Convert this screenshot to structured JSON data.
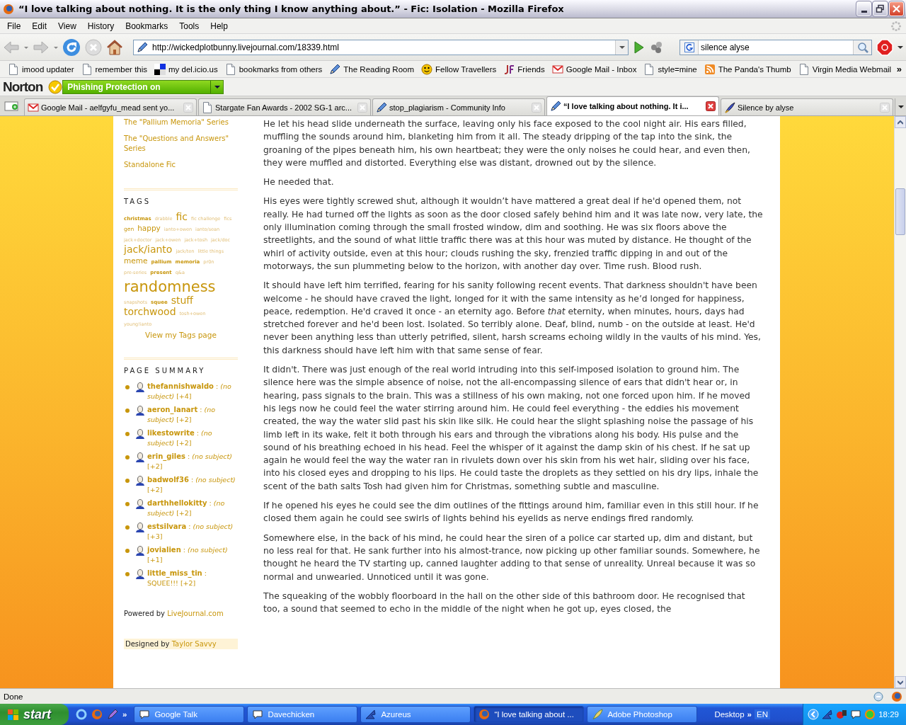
{
  "window": {
    "title": "“I love talking about nothing. It is the only thing I know anything about.” - Fic: Isolation - Mozilla Firefox"
  },
  "menu": [
    "File",
    "Edit",
    "View",
    "History",
    "Bookmarks",
    "Tools",
    "Help"
  ],
  "navigation": {
    "url": "http://wickedplotbunny.livejournal.com/18339.html",
    "search_query": "silence alyse"
  },
  "bookmarks": [
    {
      "label": "imood updater",
      "kind": "page"
    },
    {
      "label": "remember this",
      "kind": "page"
    },
    {
      "label": "my del.icio.us",
      "kind": "delicious"
    },
    {
      "label": "bookmarks from others",
      "kind": "page"
    },
    {
      "label": "The Reading Room",
      "kind": "pen"
    },
    {
      "label": "Fellow Travellers",
      "kind": "smiley"
    },
    {
      "label": "Friends",
      "kind": "monogram"
    },
    {
      "label": "Google Mail - Inbox",
      "kind": "gmail"
    },
    {
      "label": "style=mine",
      "kind": "page"
    },
    {
      "label": "The Panda's Thumb",
      "kind": "rss"
    },
    {
      "label": "Virgin Media Webmail",
      "kind": "page"
    }
  ],
  "bookmarks_overflow": "»",
  "norton": {
    "brand": "Norton",
    "status": "Phishing Protection on"
  },
  "tabs": [
    {
      "title": "Google Mail - aelfgyfu_mead sent yo...",
      "kind": "gmail",
      "selected": false
    },
    {
      "title": "Stargate Fan Awards - 2002 SG-1 arc...",
      "kind": "page",
      "selected": false
    },
    {
      "title": "stop_plagiarism - Community Info",
      "kind": "pen",
      "selected": false
    },
    {
      "title": "“I love talking about nothing. It i...",
      "kind": "pen",
      "selected": true
    },
    {
      "title": "Silence by alyse",
      "kind": "quill",
      "selected": false
    }
  ],
  "sidebar": {
    "series": [
      "The \"Pallium Memoria\" Series",
      "The \"Questions and Answers\" Series",
      "Standalone Fic"
    ],
    "tags_heading": "TAGS",
    "tags": [
      {
        "label": "christmas",
        "kind": "bold"
      },
      {
        "label": "drabble",
        "kind": "pale"
      },
      {
        "label": "fic",
        "kind": "large"
      },
      {
        "label": "fic challenge",
        "kind": "pale"
      },
      {
        "label": "fics",
        "kind": "pale"
      },
      {
        "label": "gen",
        "kind": "small"
      },
      {
        "label": "happy",
        "kind": "medium"
      },
      {
        "label": "ianto+owen",
        "kind": "pale"
      },
      {
        "label": "ianto/sean",
        "kind": "pale"
      },
      {
        "label": "jack+doctor",
        "kind": "pale"
      },
      {
        "label": "jack+owen",
        "kind": "pale"
      },
      {
        "label": "jack+tosh",
        "kind": "pale"
      },
      {
        "label": "jack/doc",
        "kind": "pale"
      },
      {
        "label": "jack/ianto",
        "kind": "large"
      },
      {
        "label": "jack/ten",
        "kind": "pale"
      },
      {
        "label": "little things",
        "kind": "pale"
      },
      {
        "label": "meme",
        "kind": "medium"
      },
      {
        "label": "pallium",
        "kind": "bold"
      },
      {
        "label": "memoria",
        "kind": "bold"
      },
      {
        "label": "pr0n",
        "kind": "pale"
      },
      {
        "label": "pre-series",
        "kind": "pale"
      },
      {
        "label": "present",
        "kind": "bold"
      },
      {
        "label": "q&a",
        "kind": "pale"
      },
      {
        "label": "randomness",
        "kind": "huge"
      },
      {
        "label": "snapshots",
        "kind": "pale"
      },
      {
        "label": "squee",
        "kind": "bold"
      },
      {
        "label": "stuff",
        "kind": "large"
      },
      {
        "label": "torchwood",
        "kind": "large"
      },
      {
        "label": "tosh+owen",
        "kind": "pale"
      },
      {
        "label": "young!ianto",
        "kind": "pale"
      }
    ],
    "tags_link": "View my Tags page",
    "summary_heading": "PAGE SUMMARY",
    "summary": [
      {
        "user": "thefannishwaldo",
        "entry": ": *(no subject)* [+4]"
      },
      {
        "user": "aeron_lanart",
        "entry": ": *(no subject)* [+2]"
      },
      {
        "user": "likestowrite",
        "entry": ": *(no subject)* [+2]"
      },
      {
        "user": "erin_giles",
        "entry": ": *(no subject)* [+2]"
      },
      {
        "user": "badwolf36",
        "entry": ": *(no subject)* [+2]"
      },
      {
        "user": "darthhellokitty",
        "entry": ": *(no subject)* [+2]"
      },
      {
        "user": "estsilvara",
        "entry": ": *(no subject)* [+3]"
      },
      {
        "user": "jovialien",
        "entry": ": *(no subject)* [+1]"
      },
      {
        "user": "little_miss_tin",
        "entry": ": SQUEE!!! [+2]"
      }
    ],
    "powered_label": "Powered by",
    "powered_link": "LiveJournal.com",
    "designed_label": "Designed by",
    "designed_link": "Taylor Savvy"
  },
  "paragraphs": [
    "He let his head slide underneath the surface, leaving only his face exposed to the cool night air. His ears filled, muffling the sounds around him, blanketing him from it all. The steady dripping of the tap into the sink, the groaning of the pipes beneath him, his own heartbeat; they were the only noises he could hear, and even then, they were muffled and distorted. Everything else was distant, drowned out by the silence.",
    "He needed that.",
    "His eyes were tightly screwed shut, although it wouldn’t have mattered a great deal if he'd opened them, not really. He had turned off the lights as soon as the door closed safely behind him and it was late now, very late, the only illumination coming through the small frosted window, dim and soothing. He was six floors above the streetlights, and the sound of what little traffic there was at this hour was muted by distance. He thought of the whirl of activity outside, even at this hour; clouds rushing the sky, frenzied traffic dipping in and out of the motorways, the sun plummeting below to the horizon, with another day over. Time rush. Blood rush.",
    "It should have left him terrified, fearing for his sanity following recent events. That darkness shouldn't have been welcome - he should have craved the light, longed for it with the same intensity as he’d longed for happiness, peace, redemption. He'd craved it once - an eternity ago. Before *that* eternity, when minutes, hours, days had stretched forever and he'd been lost. Isolated. So terribly alone. Deaf, blind, numb - on the outside at least. He'd never been anything less than utterly petrified, silent, harsh screams echoing wildly in the vaults of his mind. Yes, this darkness should have left him with that same sense of fear.",
    "It didn't. There was just enough of the real world intruding into this self-imposed isolation to ground him. The silence here was the simple absence of noise, not the all-encompassing silence of ears that didn't hear or, in hearing, pass signals to the brain. This was a stillness of his own making, not one forced upon him. If he moved his legs now he could feel the water stirring around him. He could feel everything - the eddies his movement created, the way the water slid past his skin like silk. He could hear the slight splashing noise the passage of his limb left in its wake, felt it both through his ears and through the vibrations along his body. His pulse and the sound of his breathing echoed in his head. Feel the whisper of it against the damp skin of his chest. If he sat up again he would feel the way the water ran in rivulets down over his skin from his wet hair, sliding over his face, into his closed eyes and dropping to his lips. He could taste the droplets as they settled on his dry lips, inhale the scent of the bath salts Tosh had given him for Christmas, something subtle and masculine.",
    "If he opened his eyes he could see the dim outlines of the fittings around him, familiar even in this still hour. If he closed them again he could see swirls of lights behind his eyelids as nerve endings fired randomly.",
    "Somewhere else, in the back of his mind, he could hear the siren of a police car started up, dim and distant, but no less real for that. He sank further into his almost-trance, now picking up other familiar sounds. Somewhere, he thought he heard the TV starting up, canned laughter adding to that sense of unreality. Unreal because it was so normal and unwearied. Unnoticed until it was gone.",
    "The squeaking of the wobbly floorboard in the hall on the other side of this bathroom door. He recognised that too, a sound that seemed to echo in the middle of the night when he got up, eyes closed, the"
  ],
  "status_bar": {
    "text": "Done"
  },
  "taskbar": {
    "start": "start",
    "quick_launch_more": "»",
    "tasks": [
      {
        "label": "Google Talk",
        "kind": "bubble",
        "selected": false
      },
      {
        "label": "Davechicken",
        "kind": "bubble",
        "selected": false
      },
      {
        "label": "Azureus",
        "kind": "swoosh",
        "selected": false
      },
      {
        "label": "“I love talking about ...",
        "kind": "firefox",
        "selected": true
      },
      {
        "label": "Adobe Photoshop",
        "kind": "feather",
        "selected": false
      }
    ],
    "desktop": "Desktop",
    "desktop_more": "»",
    "language": "EN",
    "clock": "18:29"
  }
}
